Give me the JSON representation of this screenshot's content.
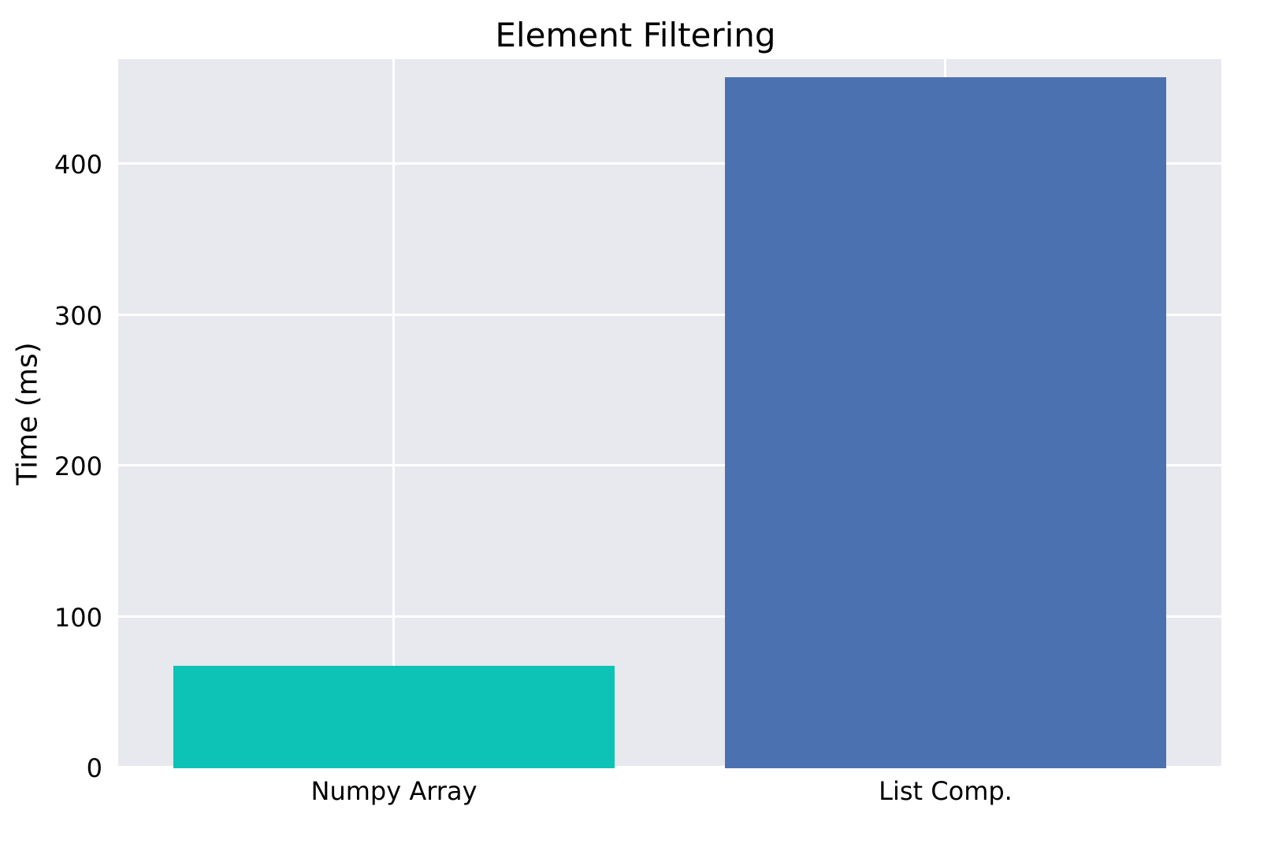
{
  "chart_data": {
    "type": "bar",
    "title": "Element Filtering",
    "xlabel": "",
    "ylabel": "Time (ms)",
    "ylim": [
      0,
      470
    ],
    "yticks": [
      0,
      100,
      200,
      300,
      400
    ],
    "categories": [
      "Numpy Array",
      "List Comp."
    ],
    "values": [
      68,
      458
    ],
    "colors": [
      "#0cc3b6",
      "#4c71b0"
    ],
    "plot_bg": "#E8E8EF"
  }
}
